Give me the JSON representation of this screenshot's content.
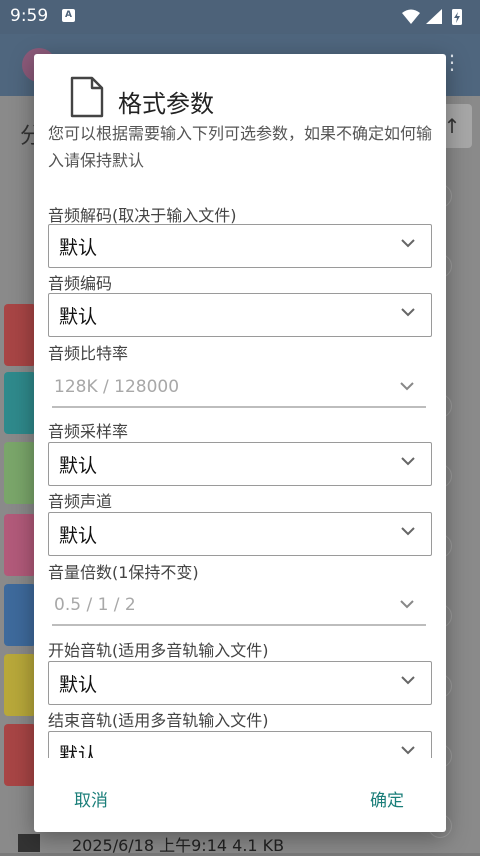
{
  "status_bar": {
    "time": "9:59",
    "notification_icon": "A"
  },
  "background": {
    "title_fragment": "分",
    "footer": "2025/6/18 上午9:14   4.1 KB"
  },
  "dialog": {
    "title": "格式参数",
    "description": "您可以根据需要输入下列可选参数，如果不确定如何输入请保持默认",
    "fields": [
      {
        "label": "音频解码(取决于输入文件)",
        "kind": "select",
        "value": "默认"
      },
      {
        "label": "音频编码",
        "kind": "select",
        "value": "默认"
      },
      {
        "label": "音频比特率",
        "kind": "input",
        "placeholder": "128K / 128000"
      },
      {
        "label": "音频采样率",
        "kind": "select",
        "value": "默认"
      },
      {
        "label": "音频声道",
        "kind": "select",
        "value": "默认"
      },
      {
        "label": "音量倍数(1保持不变)",
        "kind": "input",
        "placeholder": "0.5 / 1 / 2"
      },
      {
        "label": "开始音轨(适用多音轨输入文件)",
        "kind": "select",
        "value": "默认"
      },
      {
        "label": "结束音轨(适用多音轨输入文件)",
        "kind": "select",
        "value": "默认"
      }
    ],
    "cancel_label": "取消",
    "confirm_label": "确定"
  },
  "colors": {
    "accent": "#1a7e79",
    "status_bar": "#4d6279"
  }
}
